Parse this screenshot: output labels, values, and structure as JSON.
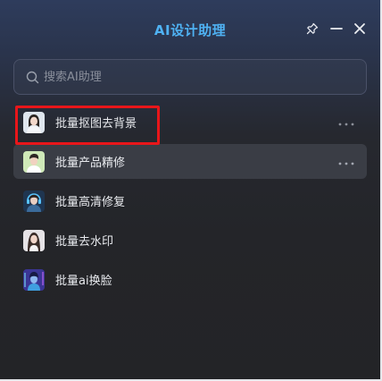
{
  "header": {
    "title": "AI设计助理",
    "pin_icon": "pin-icon",
    "minimize_icon": "minimize-icon",
    "close_icon": "close-icon"
  },
  "search": {
    "icon": "search-icon",
    "placeholder": "搜索AI助理",
    "value": ""
  },
  "assistants": [
    {
      "label": "批量抠图去背景",
      "avatar": "avatar-girl-portrait",
      "has_more": true,
      "highlighted": true
    },
    {
      "label": "批量产品精修",
      "avatar": "avatar-boy-portrait",
      "has_more": true,
      "hover": true
    },
    {
      "label": "批量高清修复",
      "avatar": "avatar-girl-headphones"
    },
    {
      "label": "批量去水印",
      "avatar": "avatar-girl-longhair"
    },
    {
      "label": "批量ai换脸",
      "avatar": "avatar-cyber-face"
    }
  ],
  "more_icon": "more-dots-icon",
  "colors": {
    "title": "#4fb2f3",
    "highlight": "#e8161a",
    "hover_row": "#3a3d45",
    "panel_top": "#2e3c5c",
    "panel_bottom": "#232427"
  }
}
